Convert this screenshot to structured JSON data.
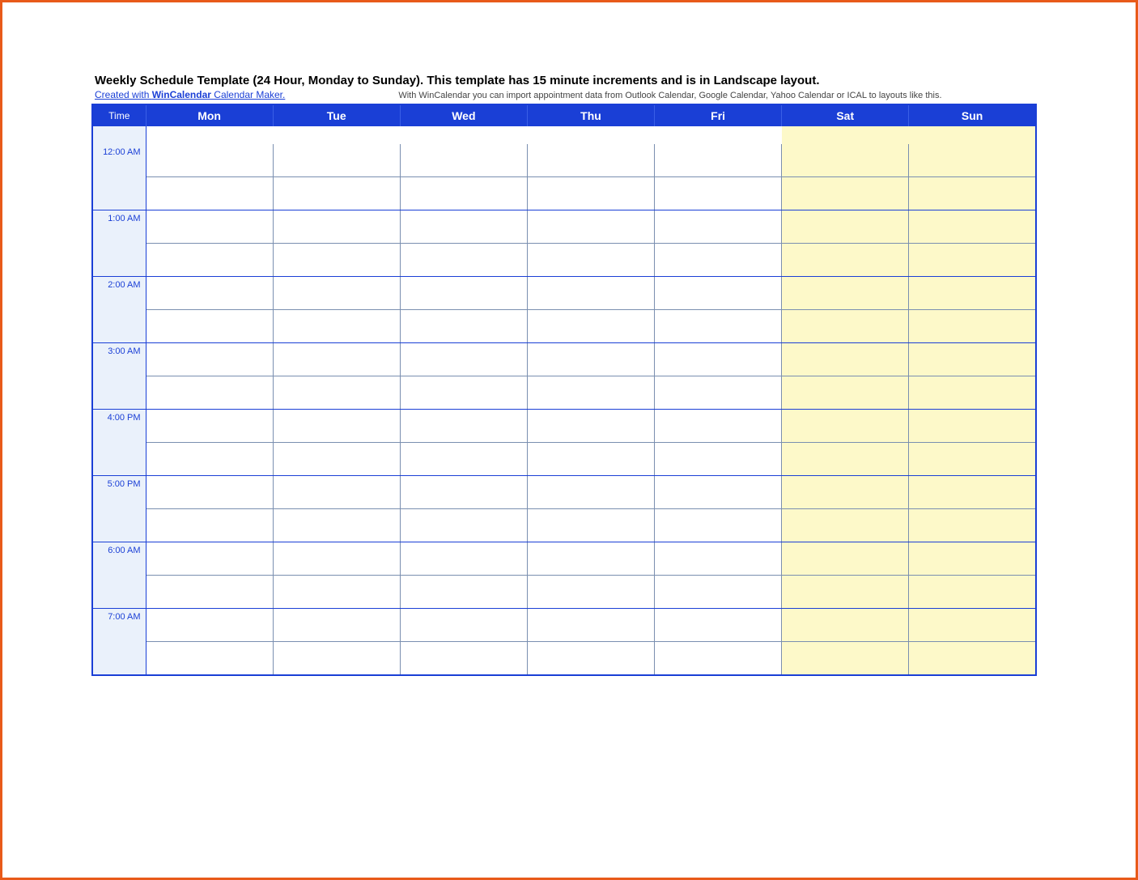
{
  "title": "Weekly Schedule Template (24 Hour, Monday to Sunday).  This template has 15 minute increments and is in Landscape layout.",
  "link": {
    "prefix": "Created with ",
    "bold": "WinCalendar",
    "suffix": " Calendar Maker."
  },
  "note": "With WinCalendar you can import appointment data from Outlook Calendar, Google Calendar, Yahoo Calendar or ICAL to layouts like this.",
  "header": {
    "time": "Time",
    "days": [
      "Mon",
      "Tue",
      "Wed",
      "Thu",
      "Fri",
      "Sat",
      "Sun"
    ]
  },
  "weekend_columns": [
    5,
    6
  ],
  "times": [
    "12:00 AM",
    "1:00 AM",
    "2:00 AM",
    "3:00 AM",
    "4:00 PM",
    "5:00 PM",
    "6:00 AM",
    "7:00 AM"
  ]
}
